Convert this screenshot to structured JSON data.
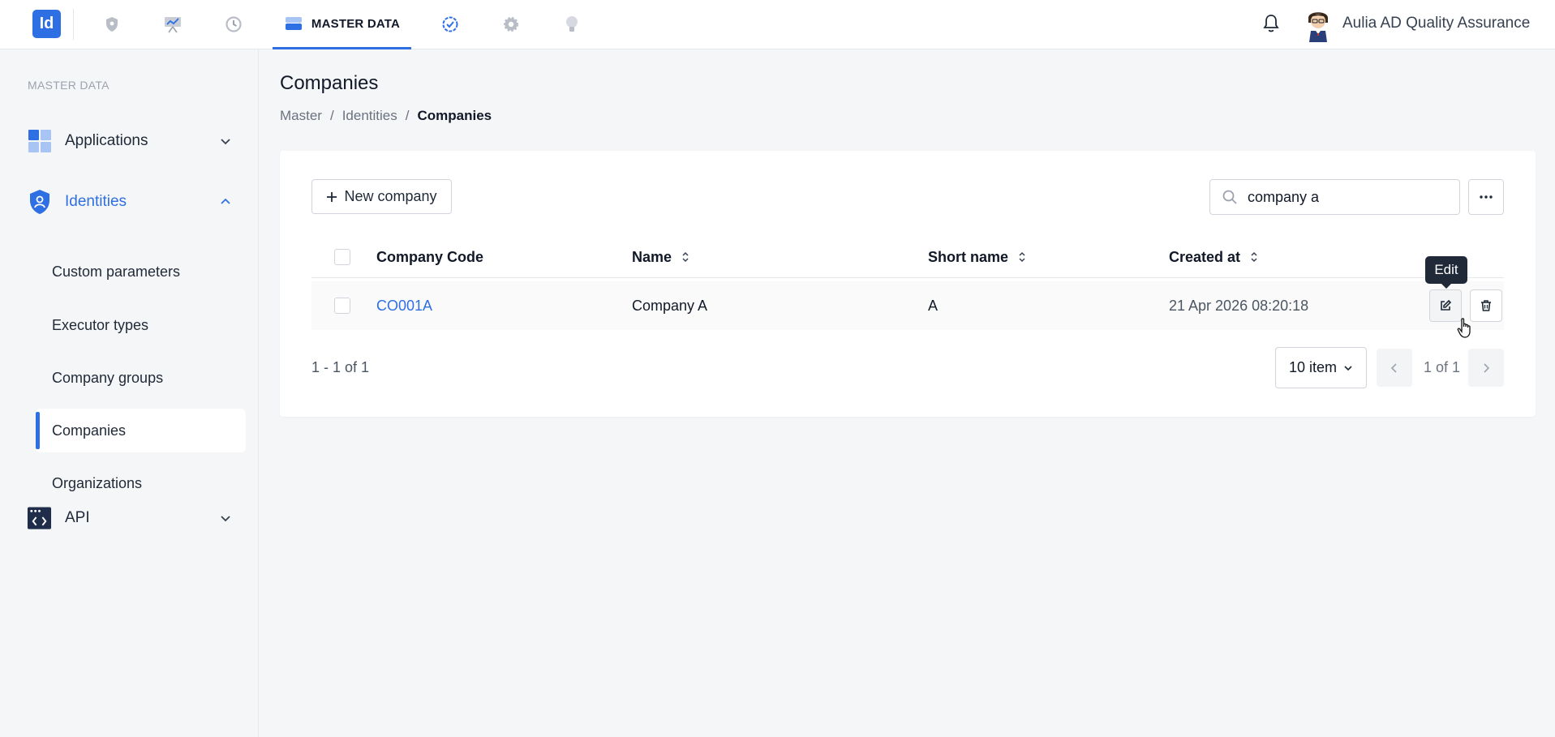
{
  "topbar": {
    "logo_text": "Id",
    "active_nav_label": "MASTER DATA",
    "nav_icons": [
      "shield-icon",
      "chart-icon",
      "history-icon",
      "master-data-icon",
      "check-circle-icon",
      "gear-icon",
      "bulb-icon"
    ],
    "user_name": "Aulia AD Quality Assurance",
    "accent": "#2f6fe4"
  },
  "sidebar": {
    "heading": "MASTER DATA",
    "groups": [
      {
        "label": "Applications",
        "icon": "apps-grid-icon",
        "expanded": false
      },
      {
        "label": "Identities",
        "icon": "identity-shield-icon",
        "expanded": true
      },
      {
        "label": "API",
        "icon": "api-code-icon",
        "expanded": false
      }
    ],
    "identities_items": [
      {
        "label": "Custom parameters"
      },
      {
        "label": "Executor types"
      },
      {
        "label": "Company groups"
      },
      {
        "label": "Companies",
        "active": true
      },
      {
        "label": "Organizations"
      }
    ]
  },
  "page": {
    "title": "Companies",
    "breadcrumb": [
      "Master",
      "/",
      "Identities",
      "/",
      "Companies"
    ]
  },
  "toolbar": {
    "new_label": "New company",
    "search_value": "company a"
  },
  "table": {
    "columns": [
      "Company Code",
      "Name",
      "Short name",
      "Created at"
    ],
    "rows": [
      {
        "code": "CO001A",
        "name": "Company A",
        "short_name": "A",
        "created_at": "21 Apr 2026 08:20:18"
      }
    ],
    "tooltip": "Edit"
  },
  "pagination": {
    "range": "1 - 1 of 1",
    "page_size": "10 item",
    "page_info": "1 of 1"
  }
}
